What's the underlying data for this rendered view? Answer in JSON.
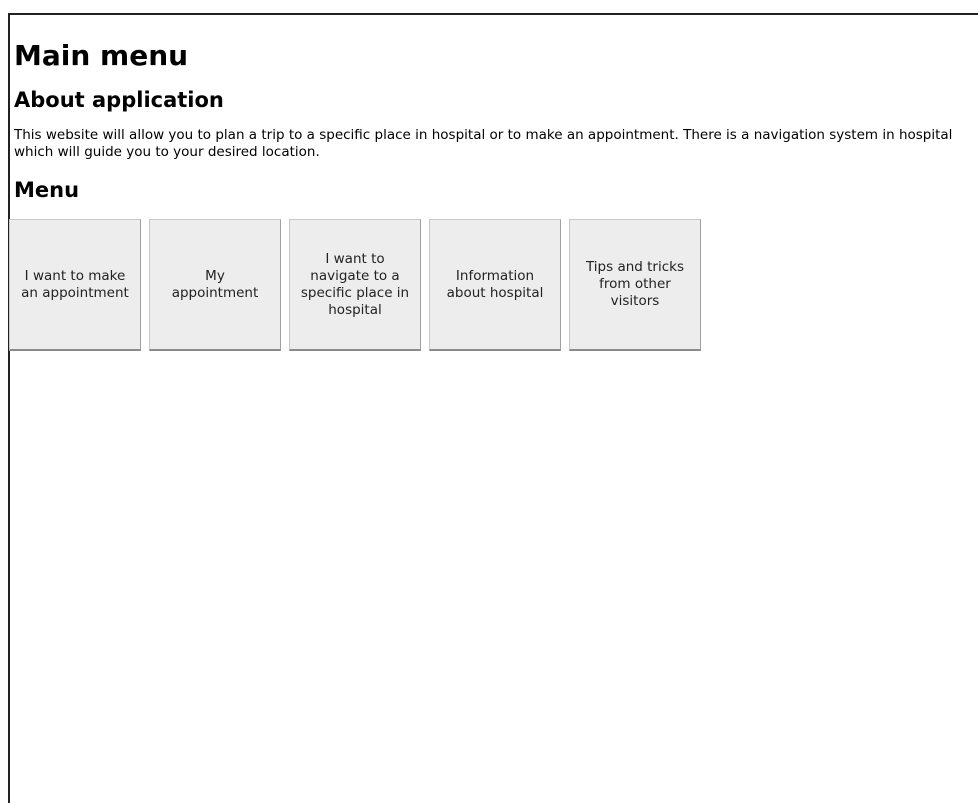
{
  "page": {
    "title": "Main menu"
  },
  "about": {
    "heading": "About application",
    "text": "This website will allow you to plan a trip to a specific place in hospital or to make an appointment. There is a navigation system in hospital which will guide you to your desired location."
  },
  "menu": {
    "heading": "Menu",
    "items": [
      {
        "label": "I want to make an appointment"
      },
      {
        "label": "My appointment"
      },
      {
        "label": "I want to navigate to a specific place in hospital"
      },
      {
        "label": "Information about hospital"
      },
      {
        "label": "Tips and tricks from other visitors"
      }
    ]
  }
}
